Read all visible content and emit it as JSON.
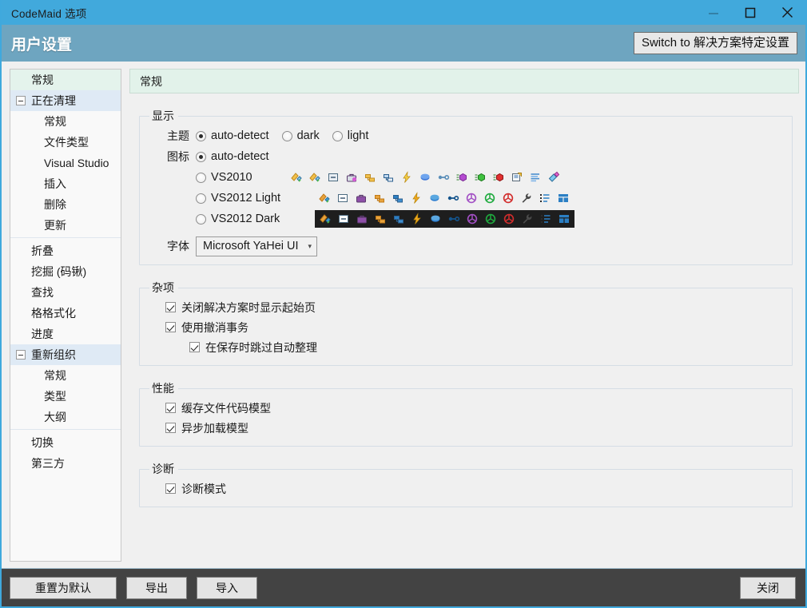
{
  "window": {
    "title": "CodeMaid 选项",
    "minimize_icon": "minimize-icon",
    "maximize_icon": "maximize-icon",
    "close_icon": "close-icon"
  },
  "header": {
    "title": "用户设置",
    "switch_button": "Switch to 解决方案特定设置"
  },
  "sidebar": {
    "items": [
      {
        "label": "常规",
        "level": 0,
        "state": "selected",
        "expander": ""
      },
      {
        "label": "正在清理",
        "level": 0,
        "state": "group",
        "expander": "minus"
      },
      {
        "label": "常规",
        "level": 1,
        "state": "",
        "expander": ""
      },
      {
        "label": "文件类型",
        "level": 1,
        "state": "",
        "expander": ""
      },
      {
        "label": "Visual Studio",
        "level": 1,
        "state": "",
        "expander": ""
      },
      {
        "label": "插入",
        "level": 1,
        "state": "",
        "expander": ""
      },
      {
        "label": "删除",
        "level": 1,
        "state": "",
        "expander": ""
      },
      {
        "label": "更新",
        "level": 1,
        "state": "",
        "expander": ""
      },
      {
        "separator": true
      },
      {
        "label": "折叠",
        "level": 0,
        "state": "",
        "expander": ""
      },
      {
        "label": "挖掘 (码锹)",
        "level": 0,
        "state": "",
        "expander": ""
      },
      {
        "label": "查找",
        "level": 0,
        "state": "",
        "expander": ""
      },
      {
        "label": "格格式化",
        "level": 0,
        "state": "",
        "expander": ""
      },
      {
        "label": "进度",
        "level": 0,
        "state": "",
        "expander": ""
      },
      {
        "label": "重新组织",
        "level": 0,
        "state": "group",
        "expander": "minus"
      },
      {
        "label": "常规",
        "level": 1,
        "state": "",
        "expander": ""
      },
      {
        "label": "类型",
        "level": 1,
        "state": "",
        "expander": ""
      },
      {
        "label": "大纲",
        "level": 1,
        "state": "",
        "expander": ""
      },
      {
        "separator": true
      },
      {
        "label": "切换",
        "level": 0,
        "state": "",
        "expander": ""
      },
      {
        "label": "第三方",
        "level": 0,
        "state": "",
        "expander": ""
      }
    ]
  },
  "pane": {
    "header": "常规",
    "display": {
      "legend": "显示",
      "theme_label": "主题",
      "theme_options": [
        {
          "label": "auto-detect",
          "selected": true
        },
        {
          "label": "dark",
          "selected": false
        },
        {
          "label": "light",
          "selected": false
        }
      ],
      "icons_label": "图标",
      "icon_options": [
        {
          "label": "auto-detect",
          "selected": true,
          "has_preview": false,
          "dark_strip": false
        },
        {
          "label": "VS2010",
          "selected": false,
          "has_preview": true,
          "dark_strip": false
        },
        {
          "label": "VS2012 Light",
          "selected": false,
          "has_preview": true,
          "dark_strip": false
        },
        {
          "label": "VS2012 Dark",
          "selected": false,
          "has_preview": true,
          "dark_strip": true
        }
      ],
      "icon_preview_names": [
        "cleanup-broom-icon",
        "comment-format-icon",
        "digging-spade-icon",
        "collapse-nodes-icon",
        "find-in-files-icon",
        "run-lightning-icon",
        "switch-file-icon",
        "join-lines-icon",
        "sort-members-purple-icon",
        "sort-members-green-icon",
        "sort-members-red-icon",
        "settings-wrench-icon",
        "reorganize-list-icon",
        "spade-layout-icon"
      ],
      "font_label": "字体",
      "font_value": "Microsoft YaHei UI",
      "font_caret": "chevron-down-icon"
    },
    "misc": {
      "legend": "杂项",
      "items": [
        {
          "label": "关闭解决方案时显示起始页",
          "checked": true,
          "indent": false
        },
        {
          "label": "使用撤消事务",
          "checked": true,
          "indent": false
        },
        {
          "label": "在保存时跳过自动整理",
          "checked": true,
          "indent": true
        }
      ]
    },
    "performance": {
      "legend": "性能",
      "items": [
        {
          "label": "缓存文件代码模型",
          "checked": true,
          "indent": false
        },
        {
          "label": "异步加载模型",
          "checked": true,
          "indent": false
        }
      ]
    },
    "diagnostics": {
      "legend": "诊断",
      "items": [
        {
          "label": "诊断模式",
          "checked": true,
          "indent": false
        }
      ]
    }
  },
  "footer": {
    "reset_label": "重置为默认",
    "export_label": "导出",
    "import_label": "导入",
    "close_label": "关闭"
  },
  "colors": {
    "titlebar": "#41a9dc",
    "header_band": "#6ea5c0",
    "dialog_bg": "#f0f0f0",
    "pane_header_bg": "#e2f2ea",
    "tree_selected": "#e4f3ec",
    "tree_group": "#dfeaf5",
    "footer_bg": "#434343",
    "window_border": "#3fa9dd"
  }
}
